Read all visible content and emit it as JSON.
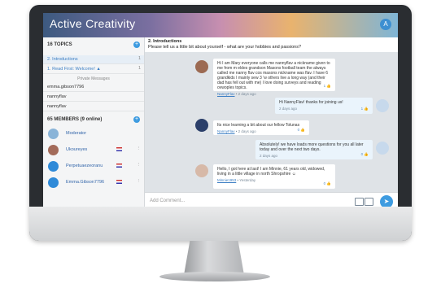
{
  "app": {
    "title": "Active Creativity",
    "user_initial": "A"
  },
  "sidebar": {
    "topics_header": "16 TOPICS",
    "topics": [
      {
        "label": "2. Introductions",
        "count": "1"
      },
      {
        "label": "1. Read First: Welcome! ▲",
        "count": "1"
      }
    ],
    "private_header": "Private Messages",
    "private": [
      {
        "label": "emma.gibson7796"
      },
      {
        "label": "nannyflav"
      },
      {
        "label": "nannyflav"
      }
    ],
    "members_header": "65 MEMBERS (9 online)",
    "members": [
      {
        "name": "Moderator"
      },
      {
        "name": "Ukoureyes"
      },
      {
        "name": "Perpetuaezeoranu"
      },
      {
        "name": "Emma.Gibson7796"
      }
    ],
    "plus": "+"
  },
  "topic": {
    "title": "2. Introductions",
    "subtitle": "Please tell us a little bit about yourself - what are your hobbies and passions?"
  },
  "messages": [
    {
      "text": "Hi I am Mary everyone calls me nannyflav a nickname given to me from m eldes grandson Masons football team the always called me nanny flav cos masons nickname was flav. I have 6 grandkids I mainly sew 3 ’w others live a long way (and their dad has fell out with me) I love doing surveys and reading ovwoples topics.",
      "author": "NannyFlav",
      "time": "2 days ago",
      "likes": "1"
    },
    {
      "text": "Hi NannyFlav! thanks for joining us!",
      "author": "",
      "time": "2 days ago",
      "likes": "1"
    },
    {
      "text": "Its nice learning a bit about our fellow Tolunas",
      "author": "NannyFlav",
      "time": "2 days ago",
      "likes": "0"
    },
    {
      "text": "Absolutely! we have loads more questions for you all later today and over the next two days.",
      "author": "",
      "time": "2 days ago",
      "likes": "0"
    },
    {
      "text": "Hello, I got here at last! I am Minnie, 61 years old, widowed, living in a little village in north Shropshire ☺",
      "author": "Minnie1953",
      "time": "Yesterday",
      "likes": "0"
    }
  ],
  "composer": {
    "placeholder": "Add Comment...",
    "send": "➤"
  },
  "colors": {
    "accent": "#3d9be0",
    "bubble_own": "#eaf4fc",
    "chat_bg": "#dfe3e7"
  }
}
